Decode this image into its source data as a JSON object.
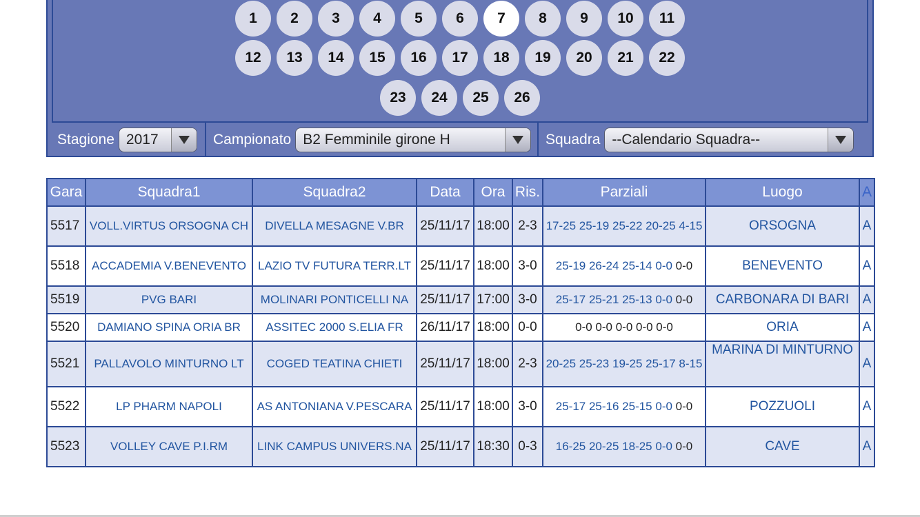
{
  "giornate": {
    "rows": [
      [
        "1",
        "2",
        "3",
        "4",
        "5",
        "6",
        "7",
        "8",
        "9",
        "10",
        "11"
      ],
      [
        "12",
        "13",
        "14",
        "15",
        "16",
        "17",
        "18",
        "19",
        "20",
        "21",
        "22"
      ],
      [
        "23",
        "24",
        "25",
        "26"
      ]
    ],
    "active": "7"
  },
  "filters": {
    "stagione_label": "Stagione",
    "stagione_value": "2017",
    "campionato_label": "Campionato",
    "campionato_value": "B2 Femminile girone H",
    "squadra_label": "Squadra",
    "squadra_value": "--Calendario Squadra--"
  },
  "table": {
    "headers": [
      "Gara",
      "Squadra1",
      "Squadra2",
      "Data",
      "Ora",
      "Ris.",
      "Parziali",
      "Luogo",
      "A"
    ],
    "rows": [
      {
        "gara": "5517",
        "squadra1": "VOLL.VIRTUS ORSOGNA CH",
        "squadra2": "DIVELLA MESAGNE V.BR",
        "data": "25/11/17",
        "ora": "18:00",
        "ris": "2-3",
        "parziali_played": "17-25 25-19 25-22 20-25 4-15",
        "parziali_rest": "",
        "luogo": "ORSOGNA",
        "a": "A"
      },
      {
        "gara": "5518",
        "squadra1": "ACCADEMIA V.BENEVENTO",
        "squadra2": "LAZIO TV FUTURA TERR.LT",
        "data": "25/11/17",
        "ora": "18:00",
        "ris": "3-0",
        "parziali_played": "25-19 26-24 25-14 0-0",
        "parziali_rest": "0-0",
        "luogo": "BENEVENTO",
        "a": "A"
      },
      {
        "gara": "5519",
        "squadra1": "PVG BARI",
        "squadra2": "MOLINARI PONTICELLI NA",
        "data": "25/11/17",
        "ora": "17:00",
        "ris": "3-0",
        "parziali_played": "25-17 25-21 25-13 0-0",
        "parziali_rest": "0-0",
        "luogo": "CARBONARA DI BARI",
        "a": "A"
      },
      {
        "gara": "5520",
        "squadra1": "DAMIANO SPINA ORIA BR",
        "squadra2": "ASSITEC 2000 S.ELIA FR",
        "data": "26/11/17",
        "ora": "18:00",
        "ris": "0-0",
        "parziali_played": "",
        "parziali_rest": "0-0 0-0 0-0 0-0 0-0",
        "luogo": "ORIA",
        "a": "A"
      },
      {
        "gara": "5521",
        "squadra1": "PALLAVOLO MINTURNO LT",
        "squadra2": "COGED TEATINA CHIETI",
        "data": "25/11/17",
        "ora": "18:00",
        "ris": "2-3",
        "parziali_played": "20-25 25-23 19-25 25-17 8-15",
        "parziali_rest": "",
        "luogo": "MARINA DI MINTURNO",
        "a": "A"
      },
      {
        "gara": "5522",
        "squadra1": "LP PHARM NAPOLI",
        "squadra2": "AS ANTONIANA V.PESCARA",
        "data": "25/11/17",
        "ora": "18:00",
        "ris": "3-0",
        "parziali_played": "25-17 25-16 25-15 0-0",
        "parziali_rest": "0-0",
        "luogo": "POZZUOLI",
        "a": "A"
      },
      {
        "gara": "5523",
        "squadra1": "VOLLEY CAVE P.I.RM",
        "squadra2": "LINK CAMPUS UNIVERS.NA",
        "data": "25/11/17",
        "ora": "18:30",
        "ris": "0-3",
        "parziali_played": "16-25 20-25 18-25 0-0",
        "parziali_rest": "0-0",
        "luogo": "CAVE",
        "a": "A"
      }
    ]
  },
  "icons": {
    "dropdown": "triangle-down-icon"
  },
  "colors": {
    "panel": "#6878b6",
    "border": "#2c4a96",
    "header": "#7d93d4",
    "link": "#2255a0",
    "row_alt": "#dfe4f3"
  }
}
